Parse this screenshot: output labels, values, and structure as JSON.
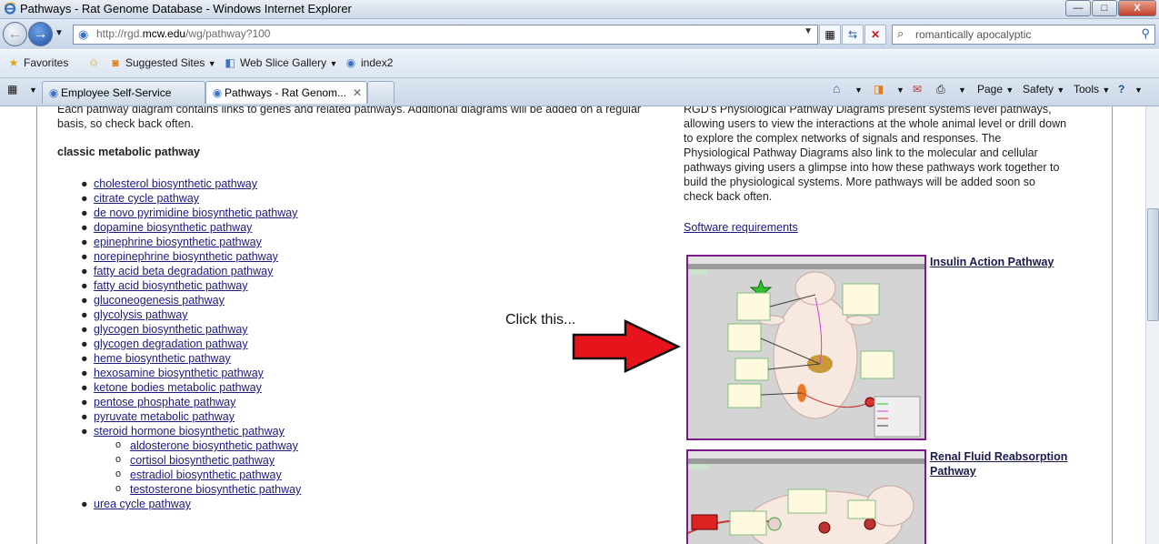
{
  "window": {
    "title": "Pathways - Rat Genome Database - Windows Internet Explorer",
    "min_label": "—",
    "max_label": "□",
    "close_label": "X"
  },
  "address_bar": {
    "url_prefix": "http://rgd.",
    "url_domain": "mcw.edu",
    "url_suffix": "/wg/pathway?100"
  },
  "search": {
    "value": "romantically apocalyptic"
  },
  "favorites_bar": {
    "favorites_label": "Favorites",
    "suggested_label": "Suggested Sites",
    "webslice_label": "Web Slice Gallery",
    "index_label": "index2"
  },
  "tabs": [
    {
      "label": "Employee Self-Service"
    },
    {
      "label": "Pathways - Rat Genom..."
    }
  ],
  "command_bar": {
    "page_label": "Page",
    "safety_label": "Safety",
    "tools_label": "Tools"
  },
  "left_column": {
    "intro_line1": "Each pathway diagram contains links to genes and related pathways. Additional diagrams will be added on a regular",
    "intro_line2": "basis, so check back often.",
    "heading": "classic metabolic pathway",
    "pathways": [
      "cholesterol biosynthetic pathway",
      "citrate cycle pathway",
      "de novo pyrimidine biosynthetic pathway",
      "dopamine biosynthetic pathway",
      "epinephrine biosynthetic pathway",
      "norepinephrine biosynthetic pathway",
      "fatty acid beta degradation pathway",
      "fatty acid biosynthetic pathway",
      "gluconeogenesis pathway",
      "glycolysis pathway",
      "glycogen biosynthetic pathway",
      "glycogen degradation pathway",
      "heme biosynthetic pathway",
      "hexosamine biosynthetic pathway",
      "ketone bodies metabolic pathway",
      "pentose phosphate pathway",
      "pyruvate metabolic pathway",
      "steroid hormone biosynthetic pathway"
    ],
    "steroid_subpathways": [
      "aldosterone biosynthetic pathway",
      "cortisol biosynthetic pathway",
      "estradiol biosynthetic pathway",
      "testosterone biosynthetic pathway"
    ],
    "last_pathway": "urea cycle pathway"
  },
  "right_column": {
    "intro_lines": [
      "RGD's Physiological Pathway Diagrams present systems level pathways,",
      "allowing users to view the interactions at the whole animal level or drill down",
      "to explore the complex networks of signals and responses.  The",
      "Physiological Pathway Diagrams also link to the molecular and cellular",
      "pathways giving users a glimpse into how these pathways work together to",
      "build the physiological systems.  More pathways will be added soon so",
      "check back often."
    ],
    "software_link": "Software requirements",
    "insulin_link": "Insulin Action Pathway",
    "renal_link_line1": "Renal Fluid Reabsorption",
    "renal_link_line2": "Pathway"
  },
  "annotation": {
    "text": "Click this...",
    "arrow_color": "#e8141c"
  },
  "colors": {
    "thumb_border": "#7a1a86",
    "link": "#1a1a80"
  }
}
